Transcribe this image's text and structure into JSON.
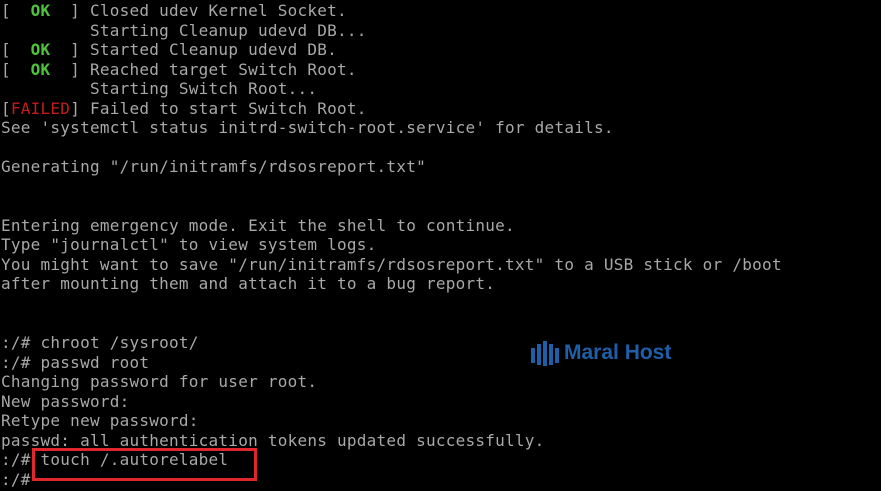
{
  "boot": {
    "l1": {
      "open": "[ ",
      "status": " OK ",
      "close": " ] ",
      "text": "Closed udev Kernel Socket."
    },
    "l2": {
      "text": "         Starting Cleanup udevd DB..."
    },
    "l3": {
      "open": "[ ",
      "status": " OK ",
      "close": " ] ",
      "text": "Started Cleanup udevd DB."
    },
    "l4": {
      "open": "[ ",
      "status": " OK ",
      "close": " ] ",
      "text": "Reached target Switch Root."
    },
    "l5": {
      "text": "         Starting Switch Root..."
    },
    "l6": {
      "open": "[",
      "status": "FAILED",
      "close": "] ",
      "text": "Failed to start Switch Root."
    },
    "l7": {
      "text": "See 'systemctl status initrd-switch-root.service' for details."
    },
    "l8": {
      "text": "Generating \"/run/initramfs/rdsosreport.txt\""
    }
  },
  "emergency": {
    "l1": "Entering emergency mode. Exit the shell to continue.",
    "l2": "Type \"journalctl\" to view system logs.",
    "l3": "You might want to save \"/run/initramfs/rdsosreport.txt\" to a USB stick or /boot",
    "l4": "after mounting them and attach it to a bug report."
  },
  "shell": {
    "l1": ":/# chroot /sysroot/",
    "l2": ":/# passwd root",
    "l3": "Changing password for user root.",
    "l4": "New password:",
    "l5": "Retype new password:",
    "l6": "passwd: all authentication tokens updated successfully.",
    "l7_prompt": ":/# ",
    "l7_cmd": "touch /.autorelabel",
    "l8": ":/# "
  },
  "watermark": {
    "text": "Maral Host",
    "icon": "maral-host-logo-icon",
    "color": "#1f5fa8"
  },
  "colors": {
    "background": "#000000",
    "text": "#a8a8a8",
    "ok": "#4ec43c",
    "failed": "#c41c1c",
    "highlight": "#e0272e"
  }
}
